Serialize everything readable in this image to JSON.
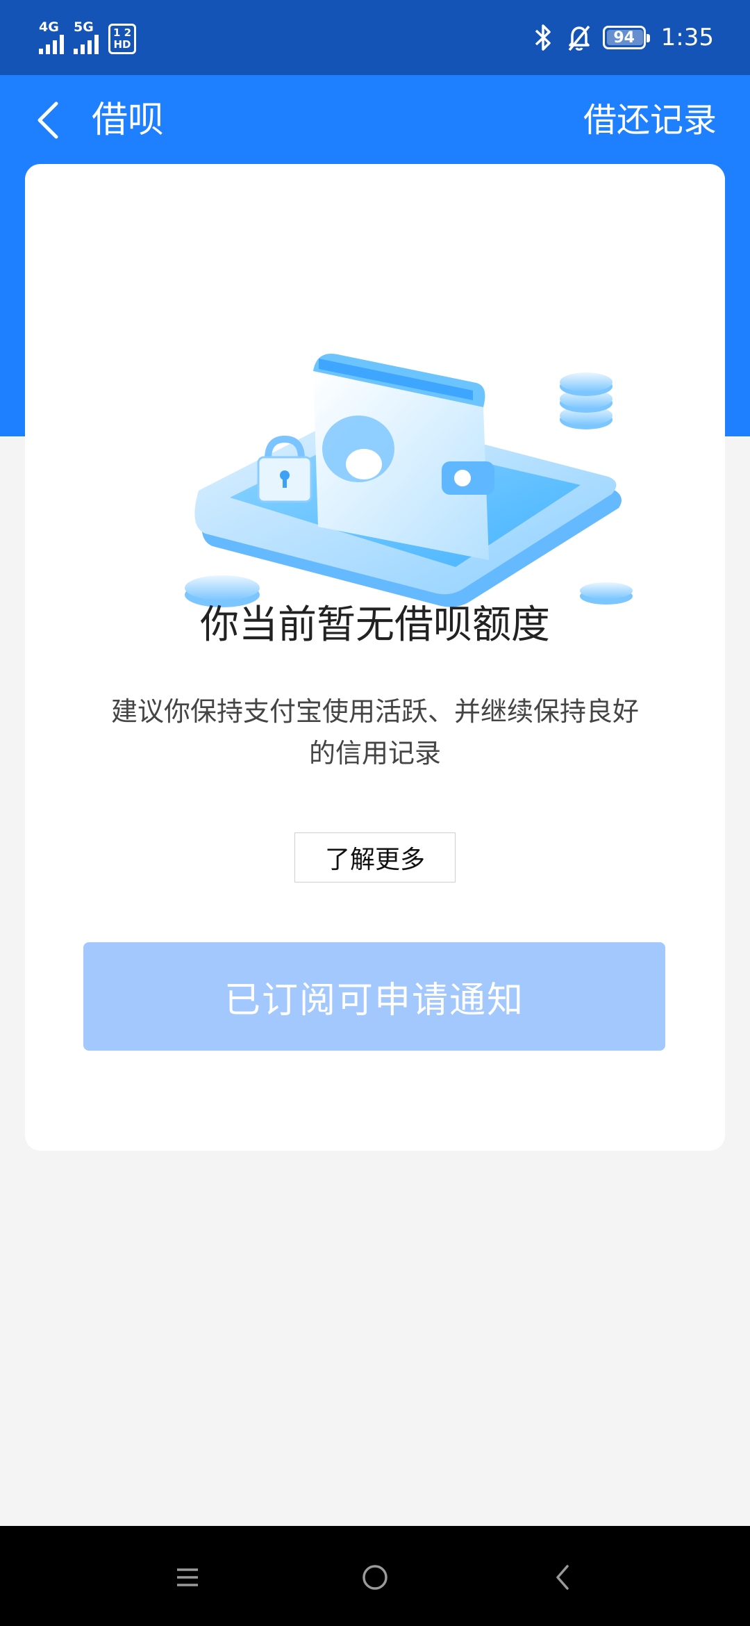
{
  "status_bar": {
    "signal1_label": "4G",
    "signal2_label": "5G",
    "hd_badge_top": "1 2",
    "hd_badge_bottom": "HD",
    "battery_level": "94",
    "time": "1:35"
  },
  "header": {
    "title": "借呗",
    "action_label": "借还记录"
  },
  "card": {
    "title": "你当前暂无借呗额度",
    "description": "建议你保持支付宝使用活跃、并继续保持良好的信用记录",
    "learn_more_label": "了解更多",
    "subscribe_label": "已订阅可申请通知"
  },
  "colors": {
    "status_bar_bg": "#1554b7",
    "header_bg": "#1e80ff",
    "button_disabled_bg": "#a2c8fd",
    "page_bg": "#f4f4f4"
  },
  "icons": {
    "back": "chevron-left-icon",
    "bluetooth": "bluetooth-icon",
    "mute": "bell-off-icon",
    "battery": "battery-icon",
    "nav_menu": "menu-icon",
    "nav_home": "home-circle-icon",
    "nav_back": "back-triangle-icon"
  }
}
